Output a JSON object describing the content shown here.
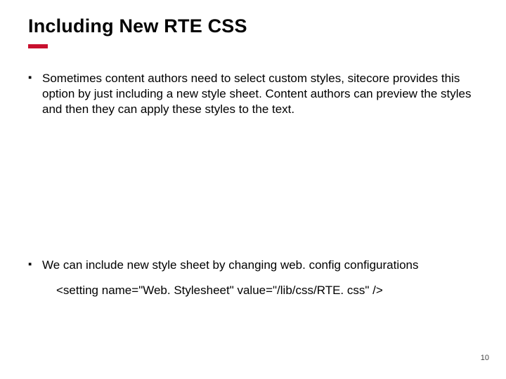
{
  "title": "Including New RTE CSS",
  "bullets": {
    "first": "Sometimes content authors need to select custom styles, sitecore provides this option by just including a new style sheet. Content authors can preview the styles and then they can apply these styles to the text.",
    "second": "We can include new style sheet by changing web. config configurations"
  },
  "code_line": "<setting name=\"Web. Stylesheet\" value=\"/lib/css/RTE. css\" />",
  "page_number": "10"
}
